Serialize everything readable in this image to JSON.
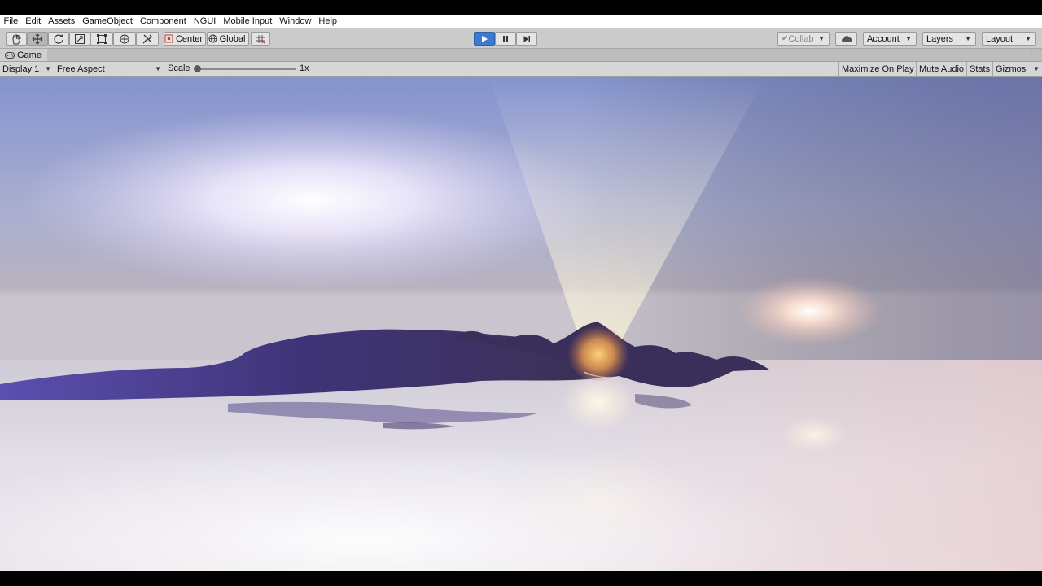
{
  "menu": [
    "File",
    "Edit",
    "Assets",
    "GameObject",
    "Component",
    "NGUI",
    "Mobile Input",
    "Window",
    "Help"
  ],
  "toolbar": {
    "tools": [
      "hand-tool-icon",
      "move-tool-icon",
      "rotate-tool-icon",
      "scale-tool-icon",
      "rect-tool-icon",
      "transform-tool-icon",
      "custom-tool-icon"
    ],
    "pivot_label": "Center",
    "space_label": "Global",
    "collab_label": "Collab",
    "account_label": "Account",
    "layers_label": "Layers",
    "layout_label": "Layout",
    "play_color": "#3c7ad1"
  },
  "game_tab": {
    "label": "Game"
  },
  "game_bar": {
    "display": "Display 1",
    "aspect": "Free Aspect",
    "scale_label": "Scale",
    "scale_value": "1x",
    "scale_fraction": 0.0,
    "maximize_label": "Maximize On Play",
    "mute_label": "Mute Audio",
    "stats_label": "Stats",
    "gizmos_label": "Gizmos"
  },
  "scene": {
    "sky_top": "#8a9ad6",
    "sky_horizon": "#b9b2c6",
    "water_color": "#e8e4ec",
    "mountain_color": "#4a3f8e",
    "sun_color": "#fff4e0"
  }
}
